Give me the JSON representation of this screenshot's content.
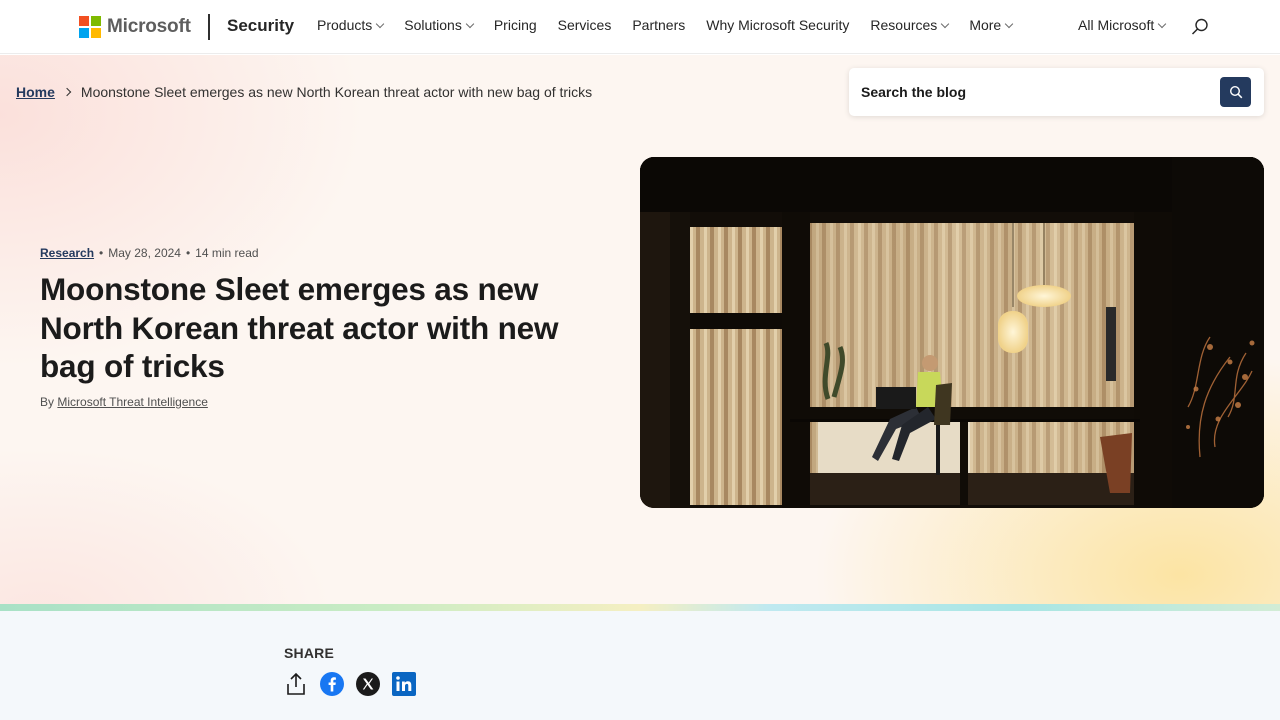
{
  "header": {
    "logo_text": "Microsoft",
    "brand": "Security",
    "nav": [
      {
        "label": "Products",
        "icon": "chevron-down-icon"
      },
      {
        "label": "Solutions",
        "icon": "chevron-down-icon"
      },
      {
        "label": "Pricing"
      },
      {
        "label": "Services"
      },
      {
        "label": "Partners"
      },
      {
        "label": "Why Microsoft Security"
      },
      {
        "label": "Resources",
        "icon": "chevron-down-icon"
      },
      {
        "label": "More",
        "icon": "chevron-down-icon"
      }
    ],
    "all_microsoft": "All Microsoft",
    "search_icon": "search-icon"
  },
  "breadcrumb": {
    "home": "Home",
    "current": "Moonstone Sleet emerges as new North Korean threat actor with new bag of tricks"
  },
  "blog_search": {
    "placeholder": "Search the blog",
    "button_icon": "search-icon"
  },
  "article": {
    "category": "Research",
    "date": "May 28, 2024",
    "read_time": "14 min read",
    "separator": "•",
    "title": "Moonstone Sleet emerges as new North Korean threat actor with new bag of tricks",
    "by": "By",
    "author": "Microsoft Threat Intelligence"
  },
  "share": {
    "label": "SHARE",
    "icons": [
      "share-icon",
      "facebook-icon",
      "x-icon",
      "linkedin-icon"
    ]
  },
  "colors": {
    "accent": "#243a5e",
    "facebook": "#1877f2",
    "linkedin": "#0a66c2"
  }
}
